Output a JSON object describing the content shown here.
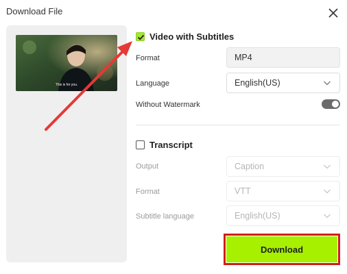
{
  "dialog": {
    "title": "Download File",
    "close_icon": "close-icon"
  },
  "preview": {
    "caption": "This is for you."
  },
  "video_section": {
    "title": "Video with Subtitles",
    "checked": true,
    "format": {
      "label": "Format",
      "value": "MP4"
    },
    "language": {
      "label": "Language",
      "value": "English(US)"
    },
    "watermark": {
      "label": "Without Watermark",
      "enabled": true
    }
  },
  "transcript_section": {
    "title": "Transcript",
    "checked": false,
    "output": {
      "label": "Output",
      "value": "Caption"
    },
    "format": {
      "label": "Format",
      "value": "VTT"
    },
    "subtitle_language": {
      "label": "Subtitle language",
      "value": "English(US)"
    }
  },
  "actions": {
    "download_label": "Download"
  },
  "colors": {
    "accent_green": "#a6f000",
    "annotation_red": "#d01c1c",
    "toggle_on": "#6b6b6b"
  }
}
